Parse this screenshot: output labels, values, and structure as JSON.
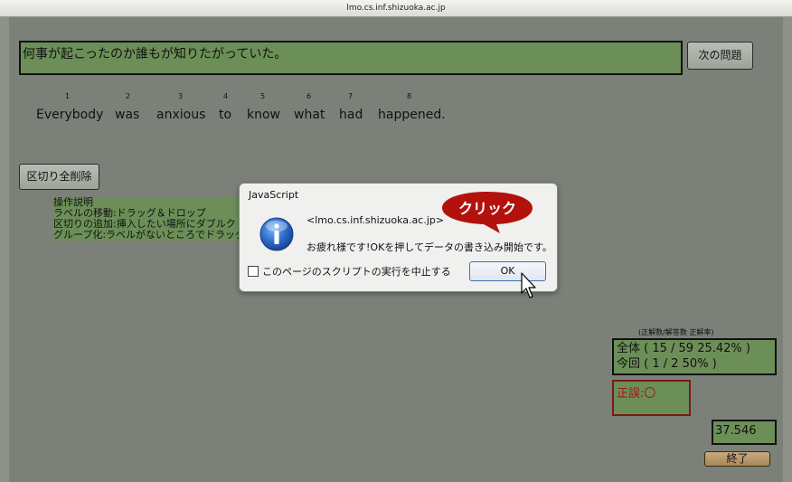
{
  "window": {
    "title": "lmo.cs.inf.shizuoka.ac.jp"
  },
  "question": {
    "japanese": "何事が起こったのか誰もが知りたがっていた。"
  },
  "buttons": {
    "next": "次の問題",
    "clear": "区切り全削除",
    "end": "終了"
  },
  "words": [
    {
      "num": "1",
      "text": "Everybody"
    },
    {
      "num": "2",
      "text": "was"
    },
    {
      "num": "3",
      "text": "anxious"
    },
    {
      "num": "4",
      "text": "to"
    },
    {
      "num": "5",
      "text": "know"
    },
    {
      "num": "6",
      "text": "what"
    },
    {
      "num": "7",
      "text": "had"
    },
    {
      "num": "8",
      "text": "happened."
    }
  ],
  "instructions": {
    "title": "操作説明",
    "line1": "ラベルの移動:ドラッグ＆ドロップ",
    "line2": "区切りの追加:挿入したい場所にダブルク",
    "line3": "グループ化:ラベルがないところでドラッグ"
  },
  "stats": {
    "header": "(正解数/解答数 正解率)",
    "overall": "全体 ( 15 / 59 25.42% )",
    "current": "今回 ( 1 / 2 50% )"
  },
  "judgement": "正誤:〇",
  "timer": "37.546",
  "dialog": {
    "title": "JavaScript",
    "domain": "<lmo.cs.inf.shizuoka.ac.jp>",
    "message": "お疲れ様です!OKを押してデータの書き込み開始です。",
    "checkbox_label": "このページのスクリプトの実行を中止する",
    "ok": "OK"
  },
  "annotation": {
    "callout": "クリック"
  },
  "colors": {
    "panel_green": "#6c8f58",
    "background": "#7b8178",
    "callout_red": "#b3120c"
  }
}
